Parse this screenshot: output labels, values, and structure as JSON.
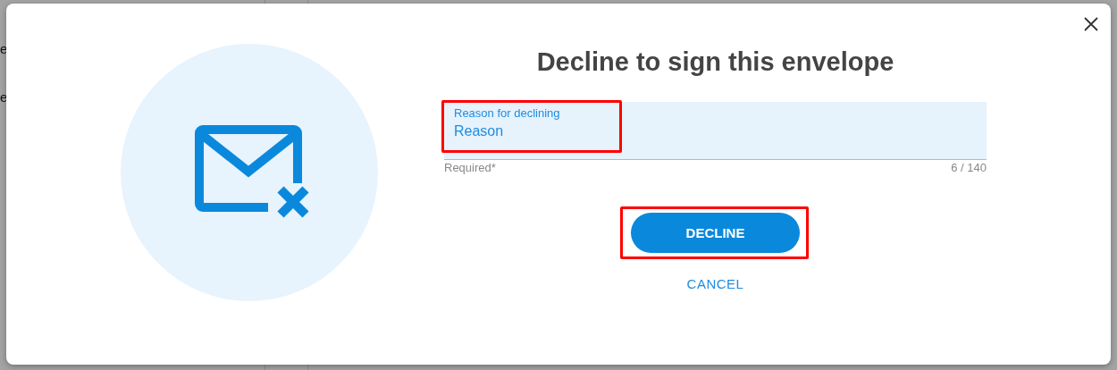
{
  "background": {
    "texts": [
      "e",
      "e"
    ]
  },
  "dialog": {
    "title": "Decline to sign this envelope",
    "field": {
      "label": "Reason for declining",
      "value": "Reason",
      "helper": "Required*",
      "counter": "6 / 140",
      "highlighted": true
    },
    "buttons": [
      {
        "kind": "primary",
        "label": "DECLINE",
        "highlighted": true
      },
      {
        "kind": "text",
        "label": "CANCEL",
        "highlighted": false
      }
    ]
  }
}
